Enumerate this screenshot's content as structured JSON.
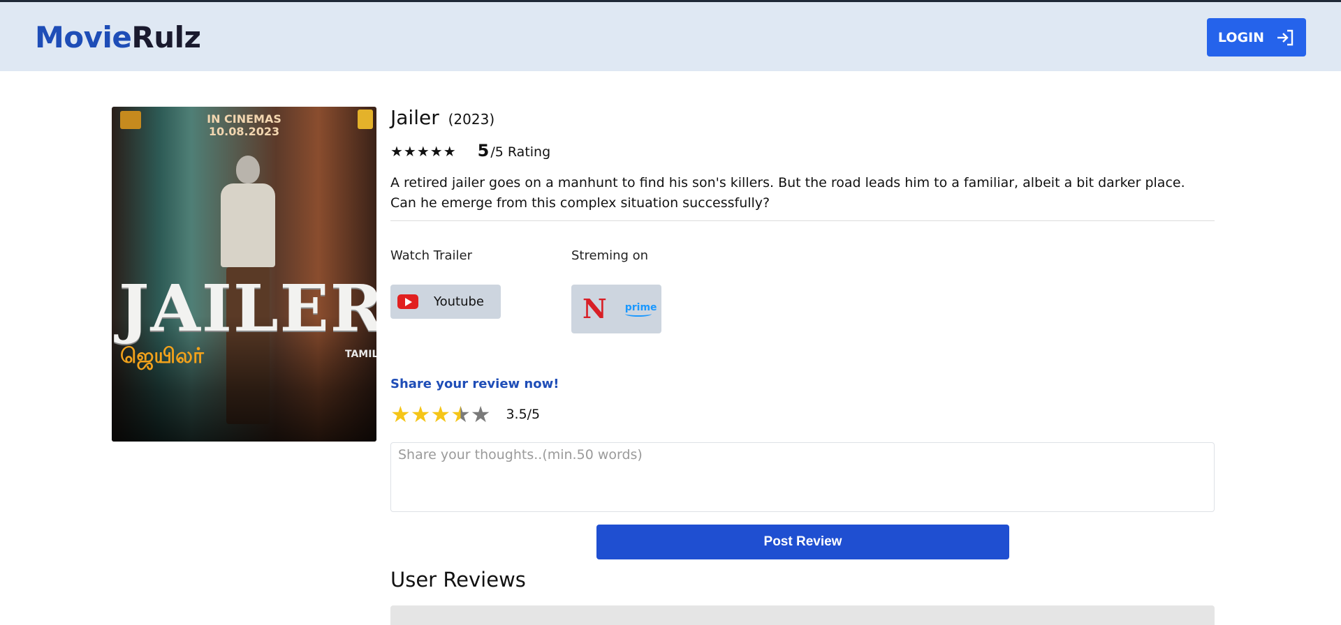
{
  "header": {
    "logo_part1": "Movie",
    "logo_part2": "Rulz",
    "login_label": "LOGIN",
    "brand_color": "#1e4db7",
    "login_color": "#2563eb"
  },
  "poster": {
    "cinemas_line1": "IN CINEMAS",
    "cinemas_line2": "10.08.2023",
    "title": "JAILER",
    "tamil_title": "ஜெயிலர்",
    "language": "TAMIL"
  },
  "movie": {
    "title": "Jailer",
    "year": "(2023)",
    "stars": "★★★★★",
    "rating_value": "5",
    "rating_suffix": "/5 Rating",
    "description": "A retired jailer goes on a manhunt to find his son's killers. But the road leads him to a familiar, albeit a bit darker place. Can he emerge from this complex situation successfully?"
  },
  "trailer": {
    "label": "Watch Trailer",
    "youtube_label": "Youtube",
    "icon": "youtube-icon"
  },
  "streaming": {
    "label": "Streming on",
    "netflix_mark": "N",
    "prime_label": "prime",
    "icons": [
      "netflix-icon",
      "prime-video-icon"
    ]
  },
  "review": {
    "heading": "Share your review now!",
    "rating": 3.5,
    "rating_text": "3.5/5",
    "placeholder": "Share your thoughts..(min.50 words)",
    "post_label": "Post Review"
  },
  "user_reviews": {
    "heading": "User Reviews"
  }
}
